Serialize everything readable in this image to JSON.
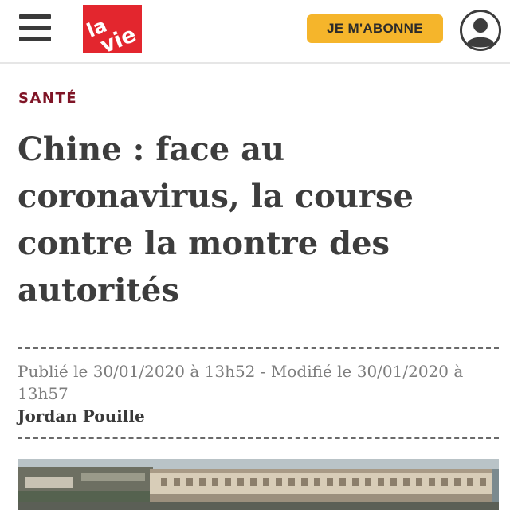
{
  "header": {
    "logo_text": "la vie",
    "subscribe_label": "JE M'ABONNE",
    "menu_icon": "hamburger-menu-icon",
    "account_icon": "user-avatar-icon",
    "colors": {
      "logo_red": "#e3262e",
      "subscribe_yellow": "#f5b52b"
    }
  },
  "article": {
    "category": "SANTÉ",
    "title": "Chine : face au coronavirus, la course contre la montre des autorités",
    "dates": "Publié le 30/01/2020 à 13h52 - Modifié le 30/01/2020 à 13h57",
    "author": "Jordan Pouille",
    "category_color": "#7f1426"
  }
}
